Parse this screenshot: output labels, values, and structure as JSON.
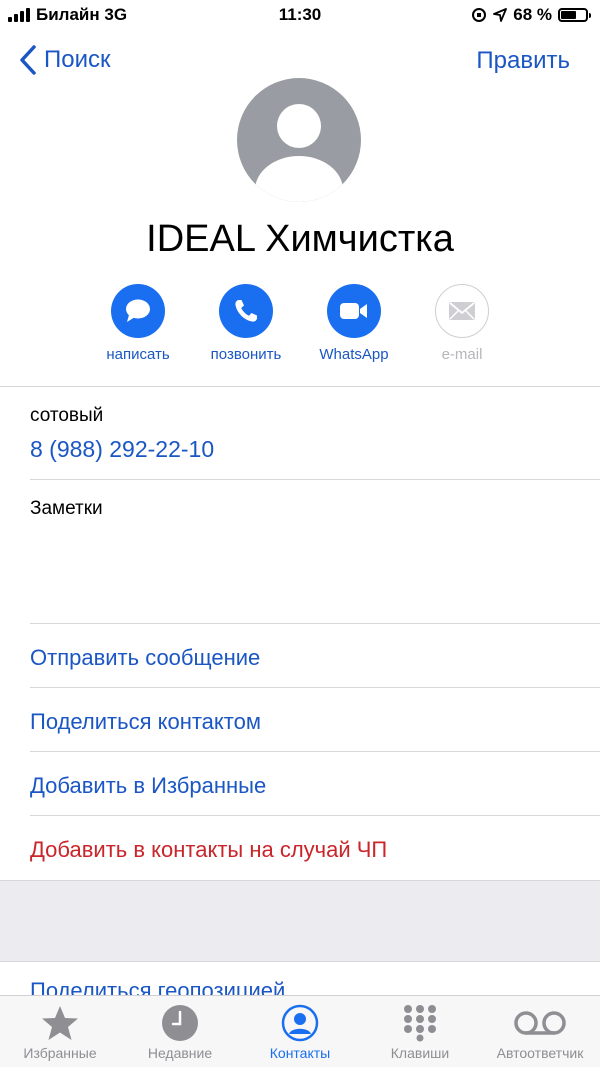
{
  "status_bar": {
    "carrier": "Билайн 3G",
    "time": "11:30",
    "battery": "68 %",
    "battery_level": 0.68
  },
  "nav": {
    "back_label": "Поиск",
    "edit_label": "Править"
  },
  "contact": {
    "name": "IDEAL Химчистка"
  },
  "actions": [
    {
      "label": "написать",
      "icon": "message-icon",
      "enabled": true
    },
    {
      "label": "позвонить",
      "icon": "phone-icon",
      "enabled": true
    },
    {
      "label": "WhatsApp",
      "icon": "video-icon",
      "enabled": true
    },
    {
      "label": "e-mail",
      "icon": "mail-icon",
      "enabled": false
    }
  ],
  "phone_field": {
    "label": "сотовый",
    "value": "8 (988) 292-22-10"
  },
  "notes": {
    "label": "Заметки"
  },
  "links": [
    {
      "label": "Отправить сообщение"
    },
    {
      "label": "Поделиться контактом"
    },
    {
      "label": "Добавить в Избранные"
    },
    {
      "label": "Добавить в контакты на случай ЧП"
    }
  ],
  "share_location": {
    "label": "Поделиться геопозицией"
  },
  "tabs": [
    {
      "label": "Избранные",
      "icon": "star-icon"
    },
    {
      "label": "Недавние",
      "icon": "clock-icon"
    },
    {
      "label": "Контакты",
      "icon": "contacts-icon",
      "active": true
    },
    {
      "label": "Клавиши",
      "icon": "keypad-icon"
    },
    {
      "label": "Автоответчик",
      "icon": "voicemail-icon"
    }
  ],
  "colors": {
    "accent": "#1a6ff0",
    "link": "#1a56c4",
    "destructive": "#c9252a",
    "avatar": "#9a9ca3"
  }
}
